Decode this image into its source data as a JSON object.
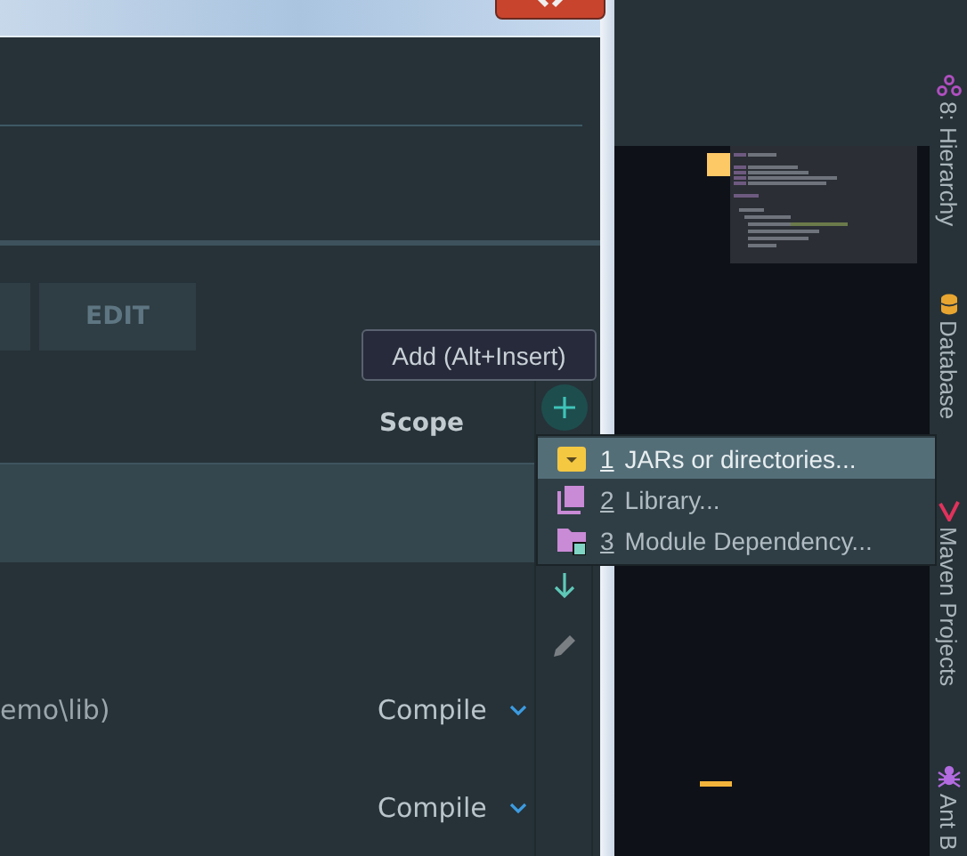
{
  "dialog": {
    "buttons": [
      {
        "label": "EDIT"
      }
    ],
    "tooltip": "Add (Alt+Insert)",
    "table": {
      "columns": [
        {
          "label": "Scope"
        }
      ],
      "rows": [
        {
          "selected": true
        },
        {
          "selected": false,
          "column_1": "emo\\lib)",
          "scope": "Compile"
        },
        {
          "selected": false,
          "scope": "Compile"
        }
      ]
    },
    "popup_menu": {
      "items": [
        {
          "mnemonic": "1",
          "label": "JARs or directories...",
          "selected": true,
          "kind": "jar"
        },
        {
          "mnemonic": "2",
          "label": "Library...",
          "selected": false,
          "kind": "library"
        },
        {
          "mnemonic": "3",
          "label": "Module Dependency...",
          "selected": false,
          "kind": "module"
        }
      ]
    }
  },
  "tool_stripe": [
    {
      "label": "8: Hierarchy",
      "kind": "hierarchy"
    },
    {
      "label": "Database",
      "kind": "database"
    },
    {
      "label": "Maven Projects",
      "kind": "maven"
    },
    {
      "label": "Ant B",
      "kind": "ant"
    }
  ]
}
